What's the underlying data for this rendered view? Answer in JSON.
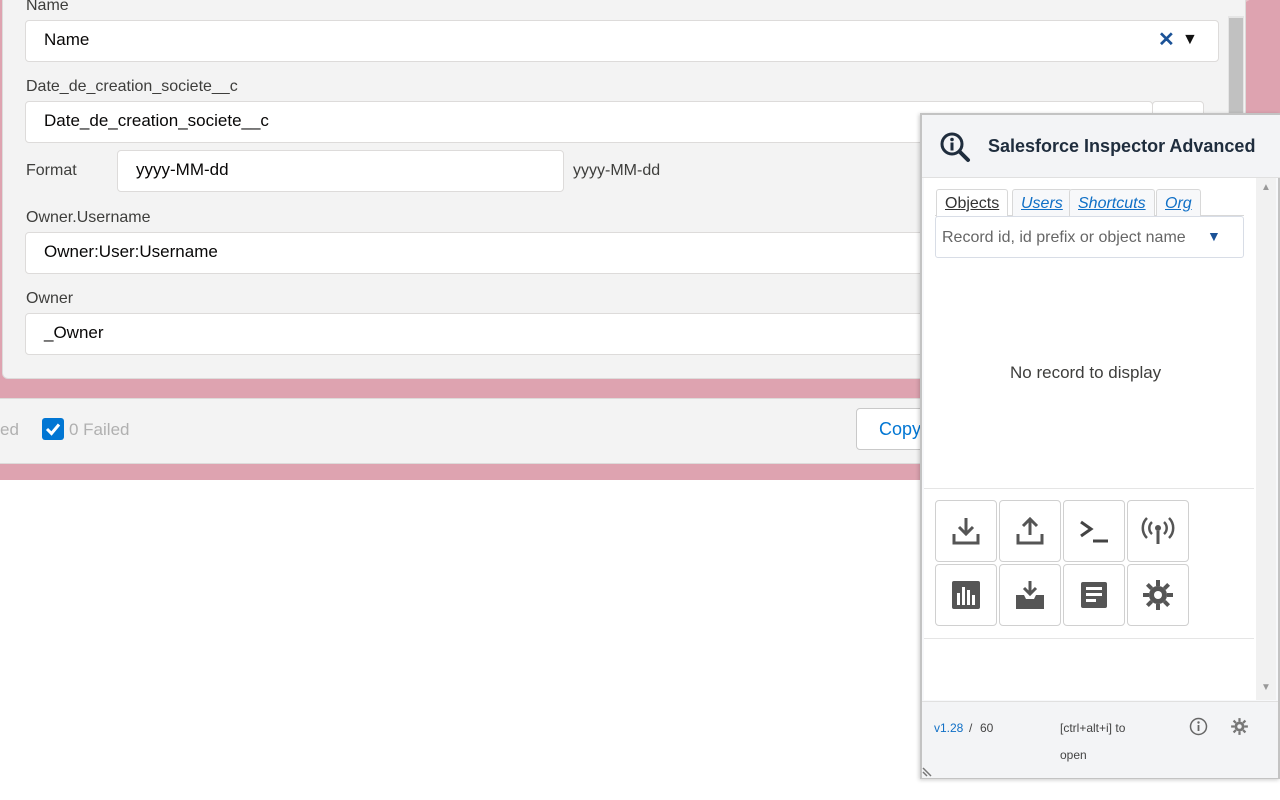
{
  "form": {
    "fields": [
      {
        "label": "Name",
        "value": "Name"
      },
      {
        "label": "Date_de_creation_societe__c",
        "value": "Date_de_creation_societe__c"
      },
      {
        "label": "Owner.Username",
        "value": "Owner:User:Username"
      },
      {
        "label": "Owner",
        "value": "_Owner"
      }
    ],
    "format_label": "Format",
    "format_value": "yyyy-MM-dd",
    "format_hint": "yyyy-MM-dd"
  },
  "footer": {
    "left_fragment": "ed",
    "failed_label": "0 Failed",
    "copy_label": "Copy",
    "checkbox_checked": true
  },
  "inspector": {
    "title": "Salesforce Inspector Advanced",
    "tabs": [
      "Objects",
      "Users",
      "Shortcuts",
      "Org"
    ],
    "active_tab": "Objects",
    "search_placeholder": "Record id, id prefix or object name",
    "empty_message": "No record to display",
    "tools_row1": [
      "download-icon",
      "upload-icon",
      "terminal-icon",
      "broadcast-icon"
    ],
    "tools_row2": [
      "chart-icon",
      "import-tray-icon",
      "article-icon",
      "gear-icon"
    ],
    "version": "v1.28",
    "separator": "/",
    "count": "60",
    "shortcut_hint": "[ctrl+alt+i] to",
    "shortcut_hint2": "open",
    "accent": "#0f6fc6",
    "header_icon_color": "#1f2d3d"
  }
}
